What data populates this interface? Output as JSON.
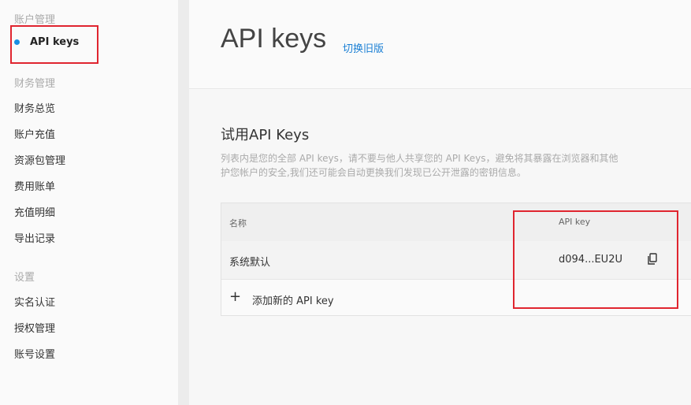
{
  "sidebar": {
    "account_header": "账户管理",
    "api_keys": "API keys",
    "finance_header": "财务管理",
    "finance_items": [
      "财务总览",
      "账户充值",
      "资源包管理",
      "费用账单",
      "充值明细",
      "导出记录"
    ],
    "settings_header": "设置",
    "settings_items": [
      "实名认证",
      "授权管理",
      "账号设置"
    ]
  },
  "header": {
    "title": "API keys",
    "switch_link": "切换旧版"
  },
  "main": {
    "section_title": "试用API Keys",
    "desc_line1": "列表内是您的全部 API keys，请不要与他人共享您的 API Keys，避免将其暴露在浏览器和其他",
    "desc_line2": "护您帐户的安全,我们还可能会自动更换我们发现已公开泄露的密钥信息。"
  },
  "table": {
    "col_name": "名称",
    "col_key": "API key",
    "rows": [
      {
        "name": "系统默认",
        "key": "d094...EU2U"
      }
    ],
    "add_label": "添加新的 API key"
  },
  "colors": {
    "accent": "#1a8fe3",
    "link": "#1a7fd4",
    "highlight_box": "#e0252f"
  },
  "icons": {
    "copy": "copy-icon",
    "add": "plus-icon"
  }
}
